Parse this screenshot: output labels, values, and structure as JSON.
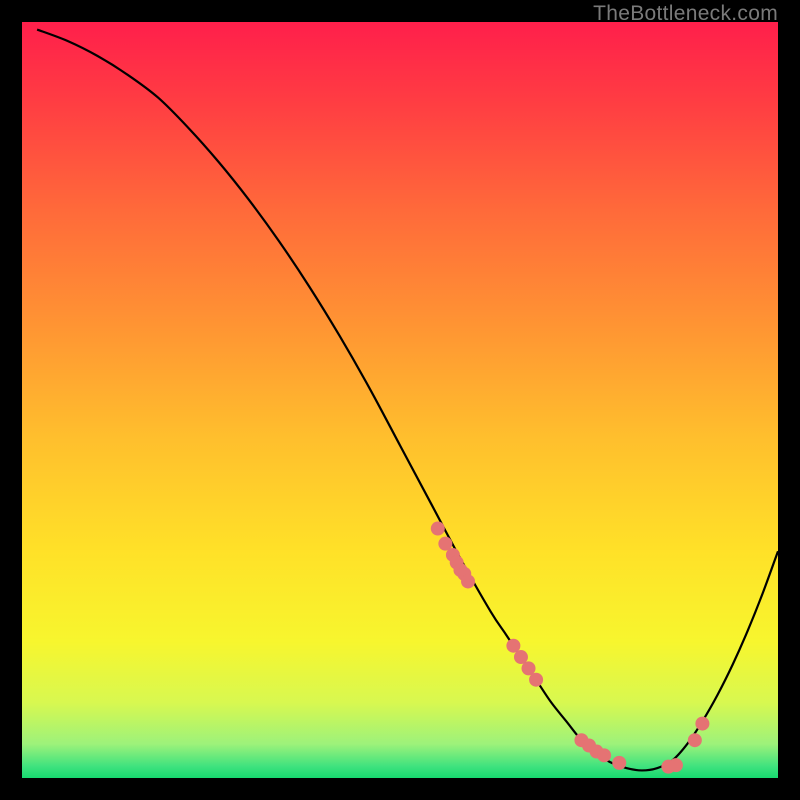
{
  "watermark": "TheBottleneck.com",
  "chart_data": {
    "type": "line",
    "title": "",
    "xlabel": "",
    "ylabel": "",
    "xlim": [
      0,
      100
    ],
    "ylim": [
      0,
      100
    ],
    "grid": false,
    "legend": false,
    "series": [
      {
        "name": "curve",
        "color": "#000000",
        "x": [
          2,
          6,
          10,
          14,
          18,
          22,
          26,
          30,
          34,
          38,
          42,
          46,
          50,
          54,
          58,
          62,
          64,
          66,
          68,
          70,
          72,
          74,
          76,
          78,
          80,
          82,
          84,
          86,
          88,
          90,
          92,
          94,
          96,
          98,
          100
        ],
        "y": [
          99,
          97.5,
          95.5,
          93,
          90,
          86,
          81.5,
          76.5,
          71,
          65,
          58.5,
          51.5,
          44,
          36.5,
          29,
          22,
          19,
          16,
          13,
          10,
          7.5,
          5,
          3.2,
          2,
          1.3,
          1,
          1.3,
          2.3,
          4.5,
          7.5,
          11,
          15,
          19.5,
          24.5,
          30
        ]
      }
    ],
    "points": {
      "name": "markers",
      "color": "#e57373",
      "radius": 7,
      "x": [
        55,
        56,
        57,
        57.5,
        58,
        58.5,
        59,
        65,
        66,
        67,
        68,
        74,
        75,
        76,
        77,
        79,
        85.5,
        86.5,
        89,
        90
      ],
      "y": [
        33,
        31,
        29.5,
        28.5,
        27.5,
        27,
        26,
        17.5,
        16,
        14.5,
        13,
        5,
        4.3,
        3.5,
        3,
        2,
        1.5,
        1.7,
        5,
        7.2
      ]
    },
    "gradient": {
      "stops": [
        {
          "offset": 0.0,
          "color": "#ff1f4b"
        },
        {
          "offset": 0.1,
          "color": "#ff3b43"
        },
        {
          "offset": 0.25,
          "color": "#ff6a3a"
        },
        {
          "offset": 0.4,
          "color": "#ff9433"
        },
        {
          "offset": 0.55,
          "color": "#ffbf2d"
        },
        {
          "offset": 0.7,
          "color": "#ffe128"
        },
        {
          "offset": 0.82,
          "color": "#f7f62e"
        },
        {
          "offset": 0.9,
          "color": "#d8f850"
        },
        {
          "offset": 0.955,
          "color": "#9df27a"
        },
        {
          "offset": 0.985,
          "color": "#3ee27e"
        },
        {
          "offset": 1.0,
          "color": "#17d96f"
        }
      ]
    }
  }
}
